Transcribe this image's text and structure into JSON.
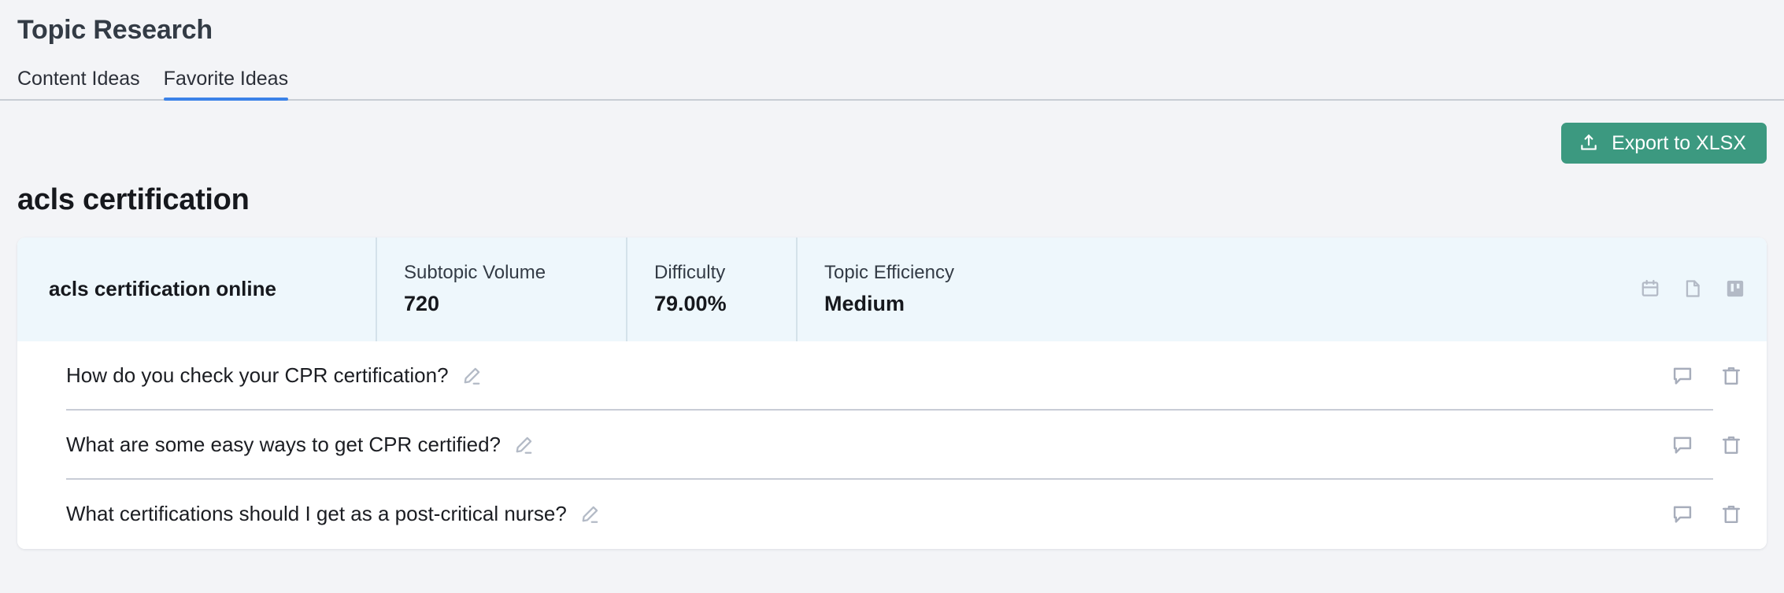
{
  "header": {
    "title": "Topic Research",
    "tabs": [
      {
        "label": "Content Ideas",
        "active": false
      },
      {
        "label": "Favorite Ideas",
        "active": true
      }
    ],
    "active_tab_color": "#3b82e8"
  },
  "toolbar": {
    "export_label": "Export to XLSX",
    "export_icon": "upload-icon",
    "export_color": "#3c9980"
  },
  "topic": {
    "title": "acls certification"
  },
  "summary": {
    "keyword": "acls certification online",
    "background_color": "#eef7fc",
    "metrics": [
      {
        "label": "Subtopic Volume",
        "value": "720"
      },
      {
        "label": "Difficulty",
        "value": "79.00%"
      },
      {
        "label": "Topic Efficiency",
        "value": "Medium"
      }
    ],
    "actions": [
      {
        "icon": "calendar-icon"
      },
      {
        "icon": "file-icon"
      },
      {
        "icon": "trello-board-icon"
      }
    ]
  },
  "questions": [
    {
      "text": "How do you check your CPR certification?",
      "edit_icon": "pencil-icon",
      "actions": [
        {
          "icon": "comment-icon"
        },
        {
          "icon": "trash-icon"
        }
      ]
    },
    {
      "text": "What are some easy ways to get CPR certified?",
      "edit_icon": "pencil-icon",
      "actions": [
        {
          "icon": "comment-icon"
        },
        {
          "icon": "trash-icon"
        }
      ]
    },
    {
      "text": "What certifications should I get as a post-critical nurse?",
      "edit_icon": "pencil-icon",
      "actions": [
        {
          "icon": "comment-icon"
        },
        {
          "icon": "trash-icon"
        }
      ]
    }
  ]
}
